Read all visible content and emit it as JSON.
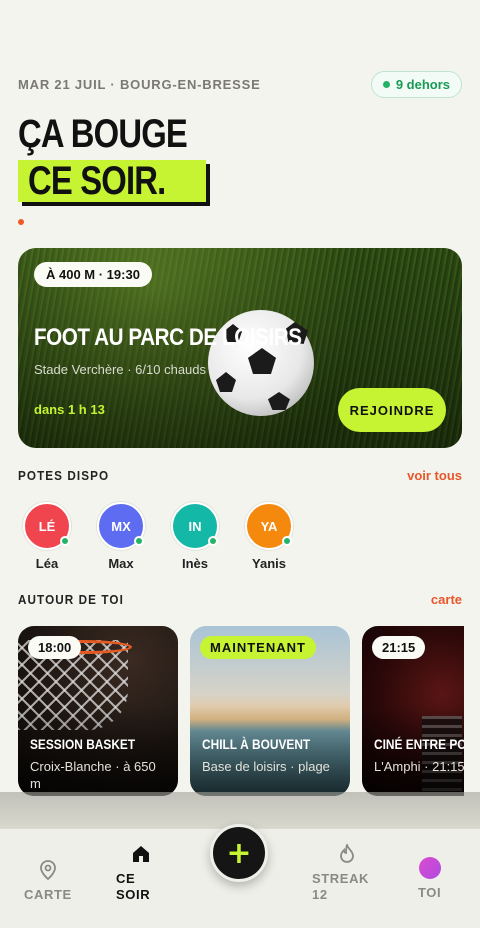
{
  "header": {
    "dateline": "MAR 21 JUIL · BOURG-EN-BRESSE",
    "outside_count": "9 dehors",
    "headline_line1": "ÇA BOUGE",
    "headline_line2": "CE SOIR."
  },
  "hero": {
    "tag": "À 400 M · 19:30",
    "title": "FOOT AU PARC DE LOISIRS",
    "subtitle": "Stade Verchère · 6/10 chauds",
    "eta": "dans 1 h 13",
    "join_label": "REJOINDRE"
  },
  "friends_section": {
    "title": "POTES DISPO",
    "link": "voir tous",
    "friends": [
      {
        "initials": "LÉ",
        "name": "Léa",
        "color": "#f0454f"
      },
      {
        "initials": "MX",
        "name": "Max",
        "color": "#5d6cf0"
      },
      {
        "initials": "IN",
        "name": "Inès",
        "color": "#14b8a6"
      },
      {
        "initials": "YA",
        "name": "Yanis",
        "color": "#f5890e"
      }
    ]
  },
  "nearby_section": {
    "title": "AUTOUR DE TOI",
    "link": "carte",
    "cards": [
      {
        "time": "18:00",
        "title": "SESSION BASKET",
        "subtitle": "Croix-Blanche · à 650 m"
      },
      {
        "time": "MAINTENANT",
        "title": "CHILL À BOUVENT",
        "subtitle": "Base de loisirs · plage"
      },
      {
        "time": "21:15",
        "title": "CINÉ ENTRE POTES",
        "subtitle": "L'Amphi · 21:15"
      }
    ]
  },
  "nav": {
    "map": "CARTE",
    "tonight": "CE SOIR",
    "add": "+",
    "streak": "STREAK 12",
    "me": "TOI"
  },
  "colors": {
    "accent": "#c6f432",
    "link": "#e8572a",
    "online": "#22b567"
  },
  "icons": {
    "map": "map-pin-icon",
    "tonight": "home-icon",
    "streak": "flame-icon",
    "me": "profile-dot-icon"
  }
}
